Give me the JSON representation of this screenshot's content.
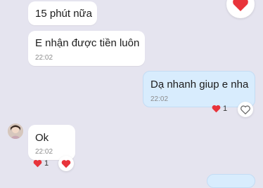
{
  "messages": [
    {
      "text": "15 phút nữa",
      "direction": "in"
    },
    {
      "text": "E nhận được tiền luôn",
      "time": "22:02",
      "direction": "in"
    },
    {
      "text": "Dạ nhanh giup e nha",
      "time": "22:02",
      "direction": "out",
      "reaction_count": "1"
    },
    {
      "text": "Ok",
      "time": "22:02",
      "direction": "in",
      "reaction_count": "1"
    }
  ],
  "icons": {
    "reaction": "heart-icon",
    "react_button": "heart-outline-icon",
    "avatar": "user-avatar"
  },
  "colors": {
    "background": "#e5e4ef",
    "incoming_bubble": "#ffffff",
    "outgoing_bubble": "#d8ecfd",
    "heart": "#e8343b"
  }
}
